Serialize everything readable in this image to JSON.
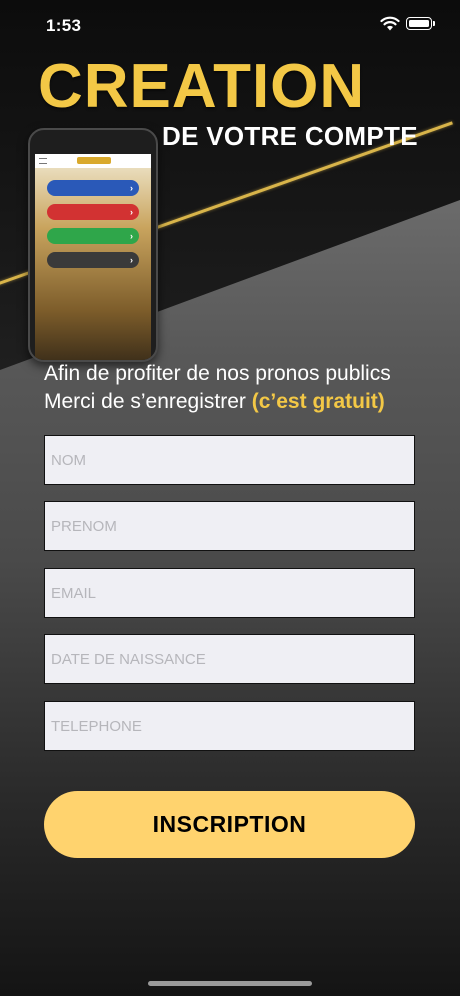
{
  "status_bar": {
    "time": "1:53"
  },
  "header": {
    "title": "CREATION",
    "subtitle": "DE VOTRE COMPTE"
  },
  "intro": {
    "line1": "Afin de profiter de nos pronos publics",
    "line2": "Merci de s’enregistrer",
    "highlight": "(c’est gratuit)"
  },
  "form": {
    "fields": [
      {
        "placeholder": "NOM",
        "value": ""
      },
      {
        "placeholder": "PRENOM",
        "value": ""
      },
      {
        "placeholder": "EMAIL",
        "value": ""
      },
      {
        "placeholder": "DATE DE NAISSANCE",
        "value": ""
      },
      {
        "placeholder": "TELEPHONE",
        "value": ""
      }
    ],
    "submit_label": "INSCRIPTION"
  },
  "colors": {
    "accent": "#f3c846",
    "button": "#ffd36e",
    "field_bg": "#efeff4"
  }
}
